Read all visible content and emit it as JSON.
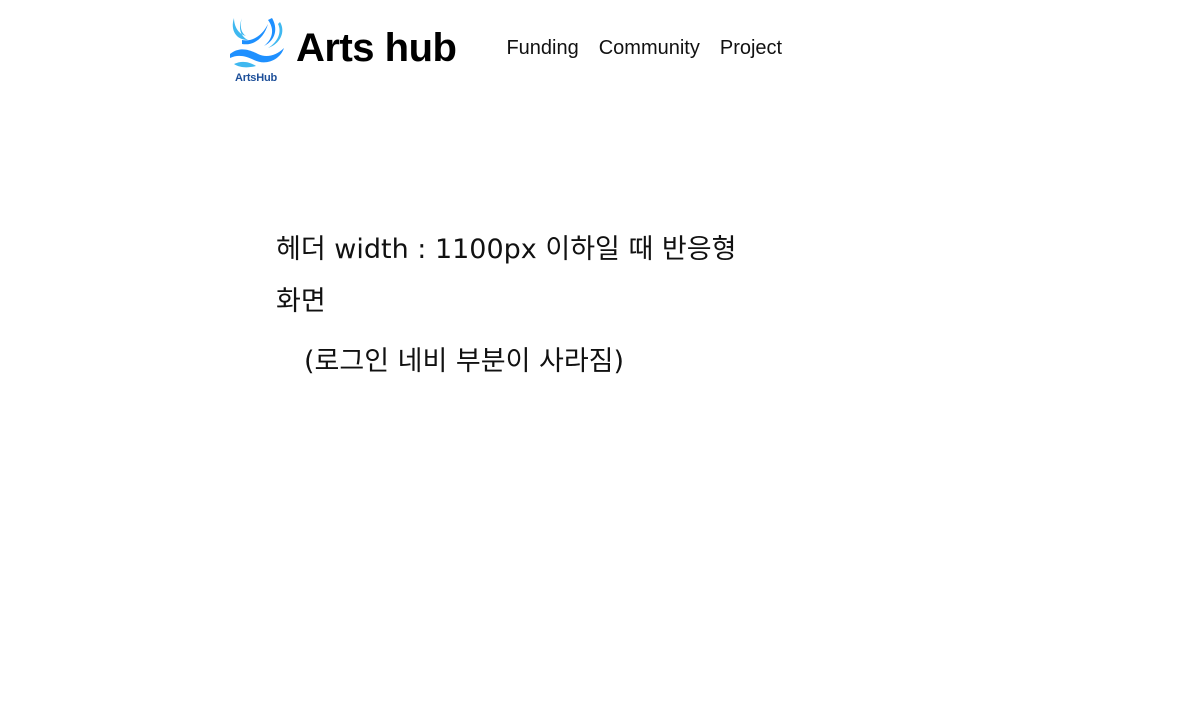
{
  "brand": {
    "logo_caption": "ArtsHub",
    "title": "Arts hub",
    "colors": {
      "logo_primary": "#1e90ff",
      "logo_light": "#3fb8f0",
      "logo_caption": "#1d4f99"
    }
  },
  "nav": {
    "items": [
      {
        "label": "Funding"
      },
      {
        "label": "Community"
      },
      {
        "label": "Project"
      }
    ]
  },
  "main": {
    "line1": "헤더 width : 1100px 이하일 때 반응형",
    "line2": "화면",
    "note": "(로그인 네비 부분이 사라짐)"
  }
}
